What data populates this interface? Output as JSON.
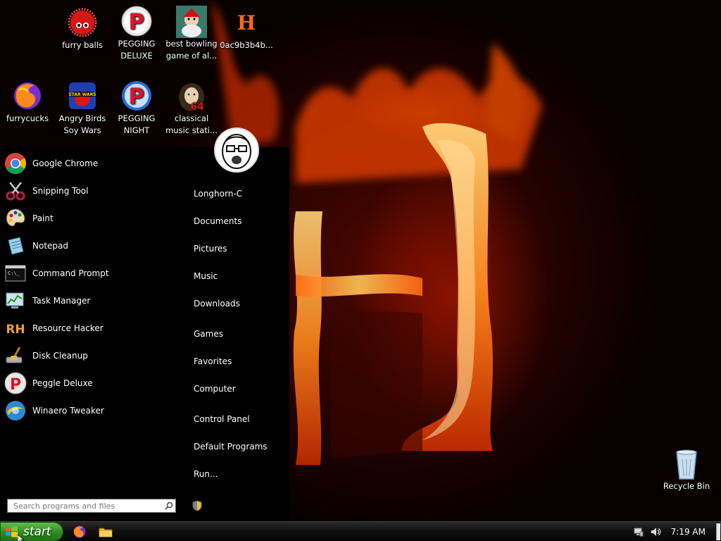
{
  "desktop": {
    "icons": [
      {
        "label_line1": "furry balls",
        "label_line2": "",
        "icon": "furry-ball-icon"
      },
      {
        "label_line1": "PEGGING",
        "label_line2": "DELUXE",
        "icon": "peggle-icon"
      },
      {
        "label_line1": "best bowling",
        "label_line2": "game of al...",
        "icon": "bowling-game-icon"
      },
      {
        "label_line1": "0ac9b3b4b...",
        "label_line2": "",
        "icon": "resource-h-icon"
      },
      {
        "label_line1": "furrycucks",
        "label_line2": "",
        "icon": "firefox-icon"
      },
      {
        "label_line1": "Angry Birds",
        "label_line2": "Soy Wars",
        "icon": "angry-birds-star-wars-icon"
      },
      {
        "label_line1": "PEGGING",
        "label_line2": "NIGHT",
        "icon": "peggle-night-icon"
      },
      {
        "label_line1": "classical",
        "label_line2": "music stati...",
        "icon": "classical-music-icon"
      }
    ],
    "recycle_bin": {
      "label": "Recycle Bin",
      "icon": "recycle-bin-icon"
    }
  },
  "start_menu": {
    "programs": [
      {
        "label": "Google Chrome",
        "icon": "chrome-icon"
      },
      {
        "label": "Snipping Tool",
        "icon": "scissors-icon"
      },
      {
        "label": "Paint",
        "icon": "paint-palette-icon"
      },
      {
        "label": "Notepad",
        "icon": "notepad-icon"
      },
      {
        "label": "Command Prompt",
        "icon": "command-prompt-icon"
      },
      {
        "label": "Task Manager",
        "icon": "task-manager-icon"
      },
      {
        "label": "Resource Hacker",
        "icon": "resource-hacker-icon"
      },
      {
        "label": "Disk Cleanup",
        "icon": "disk-cleanup-icon"
      },
      {
        "label": "Peggle Deluxe",
        "icon": "peggle-icon"
      },
      {
        "label": "Winaero Tweaker",
        "icon": "winaero-icon"
      }
    ],
    "places": [
      "Longhorn-C",
      "Documents",
      "Pictures",
      "Music",
      "Downloads",
      "Games",
      "Favorites",
      "Computer",
      "Control Panel",
      "Default Programs",
      "Run..."
    ],
    "search": {
      "placeholder": "Search programs and files"
    }
  },
  "taskbar": {
    "start_label": "start",
    "clock": "7:19 AM"
  },
  "colors": {
    "start_green": "#2d8a1e",
    "menu_bg": "#000000",
    "fire_orange": "#ff7a1a"
  }
}
